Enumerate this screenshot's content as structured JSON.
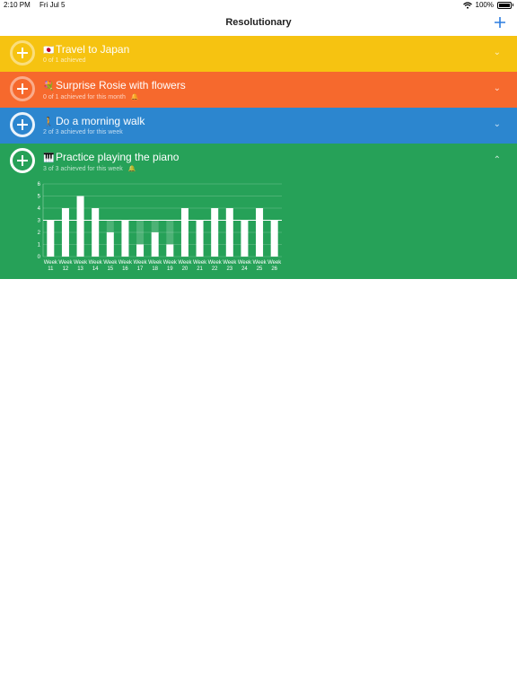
{
  "status_bar": {
    "time": "2:10 PM",
    "date": "Fri Jul 5",
    "battery": "100%"
  },
  "nav": {
    "title": "Resolutionary",
    "add_icon": "plus-icon"
  },
  "colors": {
    "yellow": "#f6c311",
    "orange": "#f6692d",
    "blue": "#2c86cf",
    "green": "#26a158",
    "accent": "#2c7de0"
  },
  "goals": [
    {
      "emoji": "🇯🇵",
      "title": "Travel to Japan",
      "subtitle": "0 of 1 achieved",
      "reminder": false,
      "expanded": false
    },
    {
      "emoji": "💐",
      "title": "Surprise Rosie with flowers",
      "subtitle": "0 of 1 achieved for this month",
      "reminder": true,
      "expanded": false
    },
    {
      "emoji": "🚶",
      "title": "Do a morning walk",
      "subtitle": "2 of 3 achieved for this week",
      "reminder": false,
      "expanded": false
    },
    {
      "emoji": "🎹",
      "title": "Practice playing the piano",
      "subtitle": "3 of 3 achieved for this week",
      "reminder": true,
      "expanded": true
    }
  ],
  "chart_data": {
    "type": "bar",
    "categories": [
      "Week\n11",
      "Week\n12",
      "Week\n13",
      "Week\n14",
      "Week\n15",
      "Week\n16",
      "Week\n17",
      "Week\n18",
      "Week\n19",
      "Week\n20",
      "Week\n21",
      "Week\n22",
      "Week\n23",
      "Week\n24",
      "Week\n25",
      "Week\n26"
    ],
    "values": [
      3,
      4,
      5,
      4,
      2,
      3,
      1,
      2,
      1,
      4,
      3,
      4,
      4,
      3,
      4,
      3
    ],
    "target": 3,
    "ylim": [
      0,
      6
    ],
    "yticks": [
      "0",
      "1",
      "2",
      "3",
      "4",
      "5",
      "6"
    ],
    "grid": true
  }
}
